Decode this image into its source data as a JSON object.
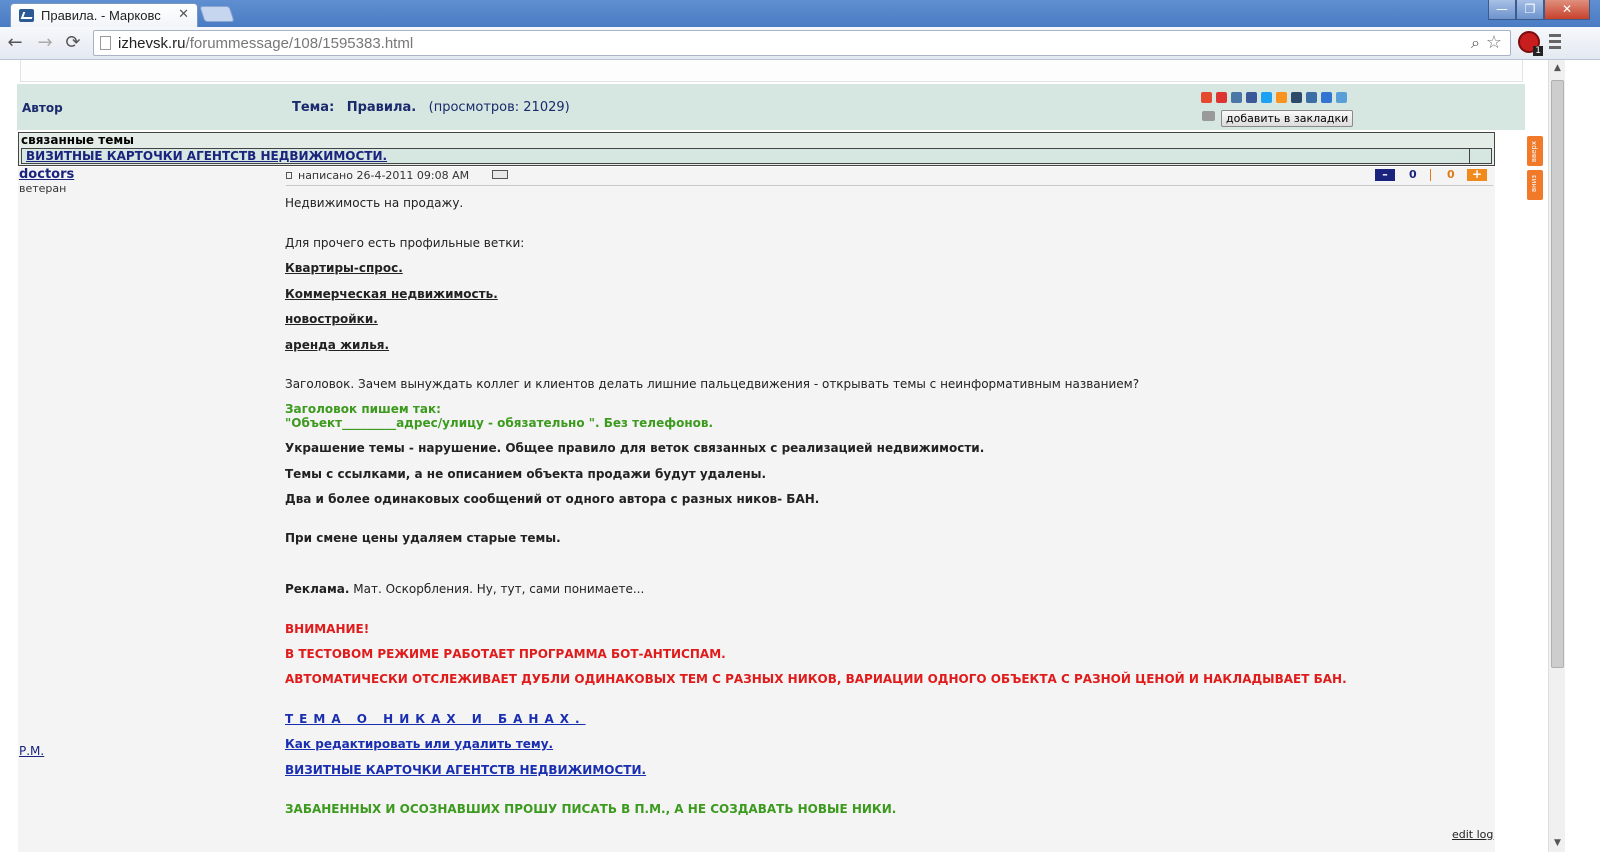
{
  "browser": {
    "tab_title": "Правила. - Марковс",
    "tab_close": "✕",
    "url_host": "izhevsk.ru",
    "url_path": "/forummessage/108/1595383.html",
    "back_icon": "←",
    "forward_icon": "→",
    "reload_icon": "⟳",
    "minimize": "—",
    "maximize": "❐",
    "close": "✕"
  },
  "header": {
    "author_label": "Автор",
    "topic_prefix": "Тема:",
    "topic_title": "Правила.",
    "views": "(просмотров: 21029)",
    "bookmark_button": "добавить в закладки",
    "social_icons": [
      "google-icon",
      "moimir-icon",
      "vk-icon",
      "facebook-icon",
      "twitter-icon",
      "odnoklassniki-icon",
      "livejournal-icon",
      "link-icon",
      "delicious-icon",
      "more-icon"
    ],
    "social_colors": [
      "#e34a2f",
      "#d33",
      "#4a76a8",
      "#3b5998",
      "#1da1f2",
      "#f7931e",
      "#2d4a6b",
      "#3a6ea5",
      "#3274d1",
      "#5aa0d8"
    ]
  },
  "related": {
    "title": "связанные темы",
    "link": "ВИЗИТНЫЕ КАРТОЧКИ АГЕНТСТВ НЕДВИЖИМОСТИ."
  },
  "post": {
    "author": "doctors",
    "rank": "ветеран",
    "pm": "Р.М.",
    "meta": "написано 26-4-2011 09:08 AM",
    "rating_minus": "–",
    "rating_neg": "0",
    "rating_pos": "0",
    "rating_plus": "+",
    "lines": {
      "l1": "Недвижимость на продажу.",
      "l2": "Для прочего есть профильные ветки:",
      "l3": "Квартиры-спрос.",
      "l4": "Коммерческая недвижимость.",
      "l5": "новостройки.",
      "l6": "аренда жилья.",
      "l7": "Заголовок. Зачем вынуждать коллег и клиентов делать лишние пальцедвижения - открывать темы с неинформативным названием?",
      "l8": "Заголовок пишем так:",
      "l9": "\"Объект_________адрес/улицу - обязательно \". Без телефонов.",
      "l10": "Украшение темы - нарушение. Общее правило для веток связанных с реализацией недвижимости.",
      "l11": "Темы с ссылками, а не описанием объекта продажи будут удалены.",
      "l12": "Два и более одинаковых сообщений от одного автора с разных ников- БАН.",
      "l13": "При смене цены удаляем старые темы.",
      "l14a": "Реклама.",
      "l14b": " Мат. Оскорбления. Ну, тут, сами понимаете...",
      "l15": "ВНИМАНИЕ!",
      "l16": "В ТЕСТОВОМ РЕЖИМЕ РАБОТАЕТ ПРОГРАММА БОТ-АНТИСПАМ.",
      "l17": "АВТОМАТИЧЕСКИ ОТСЛЕЖИВАЕТ ДУБЛИ ОДИНАКОВЫХ ТЕМ С РАЗНЫХ НИКОВ, ВАРИАЦИИ ОДНОГО ОБЪЕКТА С РАЗНОЙ ЦЕНОЙ И НАКЛАДЫВАЕТ БАН.",
      "l18": "ТЕМА О НИКАХ И БАНАХ.",
      "l19": "Как редактировать или удалить тему.",
      "l20": "ВИЗИТНЫЕ КАРТОЧКИ АГЕНТСТВ НЕДВИЖИМОСТИ.",
      "l21": "ЗАБАНЕННЫХ И ОСОЗНАВШИХ ПРОШУ ПИСАТЬ В П.М., А НЕ СОЗДАВАТЬ НОВЫЕ НИКИ."
    },
    "edit_log": "edit log"
  },
  "side_buttons": {
    "up": "вверх",
    "down": "вниз"
  },
  "colors": {
    "header_bg": "#d6e6e0",
    "link_navy": "#1a237e",
    "green": "#3c9a1e",
    "red": "#e01b1b",
    "blue": "#1a2fb0",
    "orange": "#f07a2a"
  }
}
